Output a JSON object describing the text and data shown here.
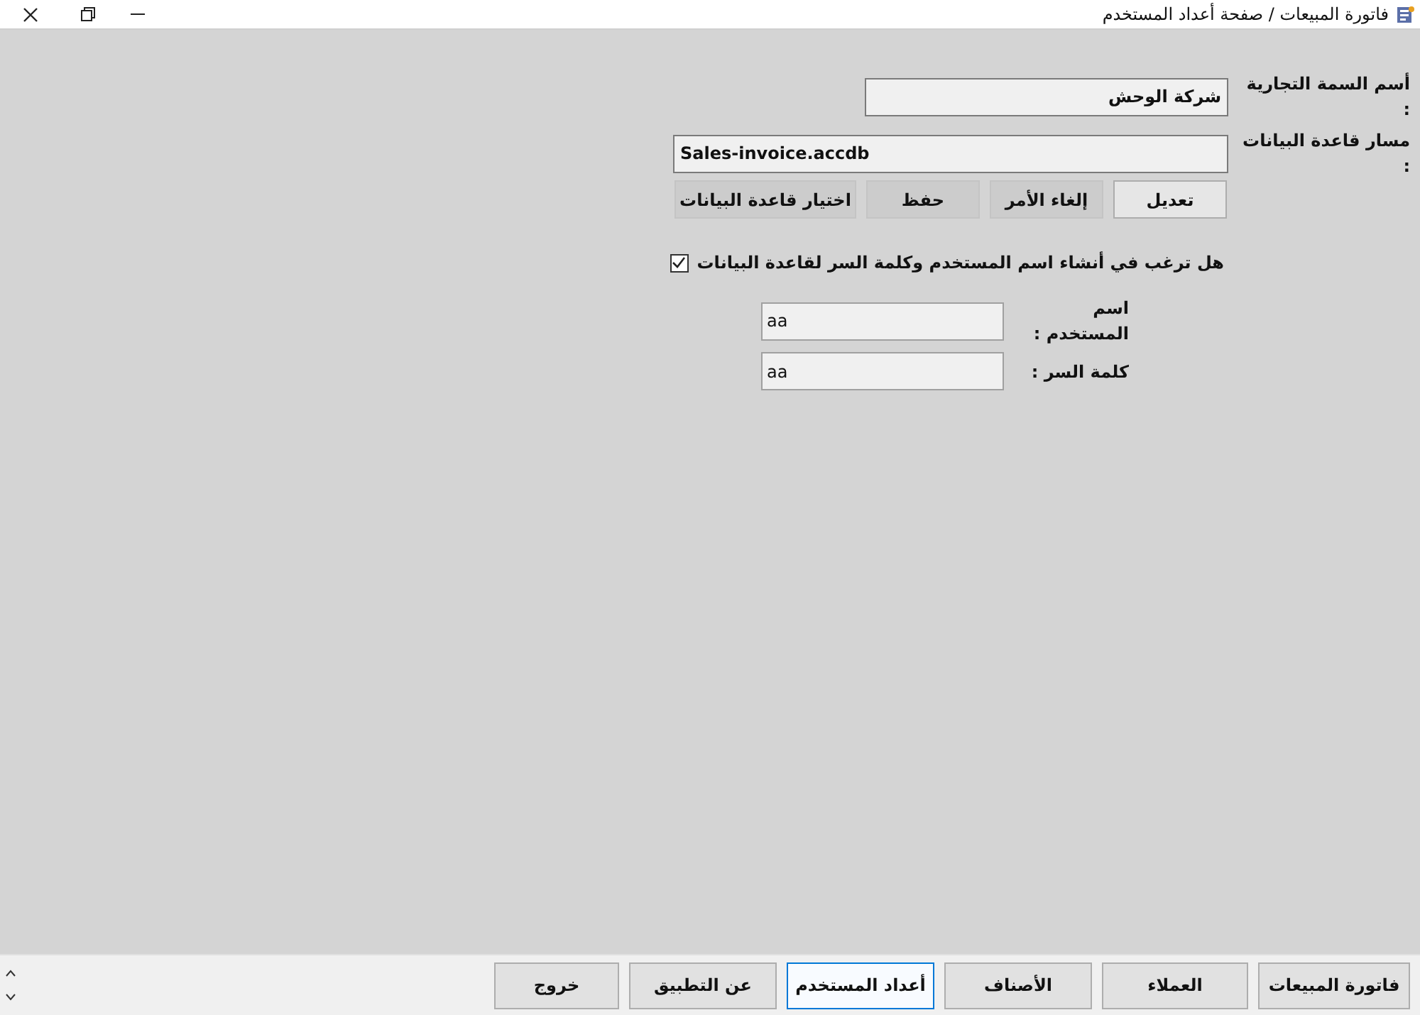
{
  "window": {
    "title": "فاتورة المبيعات / صفحة أعداد المستخدم"
  },
  "form": {
    "fields": [
      {
        "label": "أسم السمة التجارية :",
        "value": "شركة الوحش",
        "kind": "rtl"
      },
      {
        "label": "مسار قاعدة البيانات :",
        "value": "Sales-invoice.accdb",
        "kind": "ltr"
      }
    ],
    "buttons": [
      {
        "label": "تعديل",
        "disabled": false
      },
      {
        "label": "إلغاء الأمر",
        "disabled": true
      },
      {
        "label": "حفظ",
        "disabled": true
      },
      {
        "label": "اختيار قاعدة البيانات",
        "disabled": true
      }
    ],
    "create_user": {
      "label": "هل ترغب في أنشاء اسم المستخدم وكلمة السر لقاعدة البيانات",
      "checked": true
    },
    "user_fields": [
      {
        "label": "اسم المستخدم :",
        "value": "aa"
      },
      {
        "label": "كلمة السر :",
        "value": "aa"
      }
    ]
  },
  "nav": [
    {
      "label": "فاتورة المبيعات",
      "selected": false
    },
    {
      "label": "العملاء",
      "selected": false
    },
    {
      "label": "الأصناف",
      "selected": false
    },
    {
      "label": "أعداد المستخدم",
      "selected": true
    },
    {
      "label": "عن التطبيق",
      "selected": false
    },
    {
      "label": "خروج",
      "selected": false
    }
  ]
}
